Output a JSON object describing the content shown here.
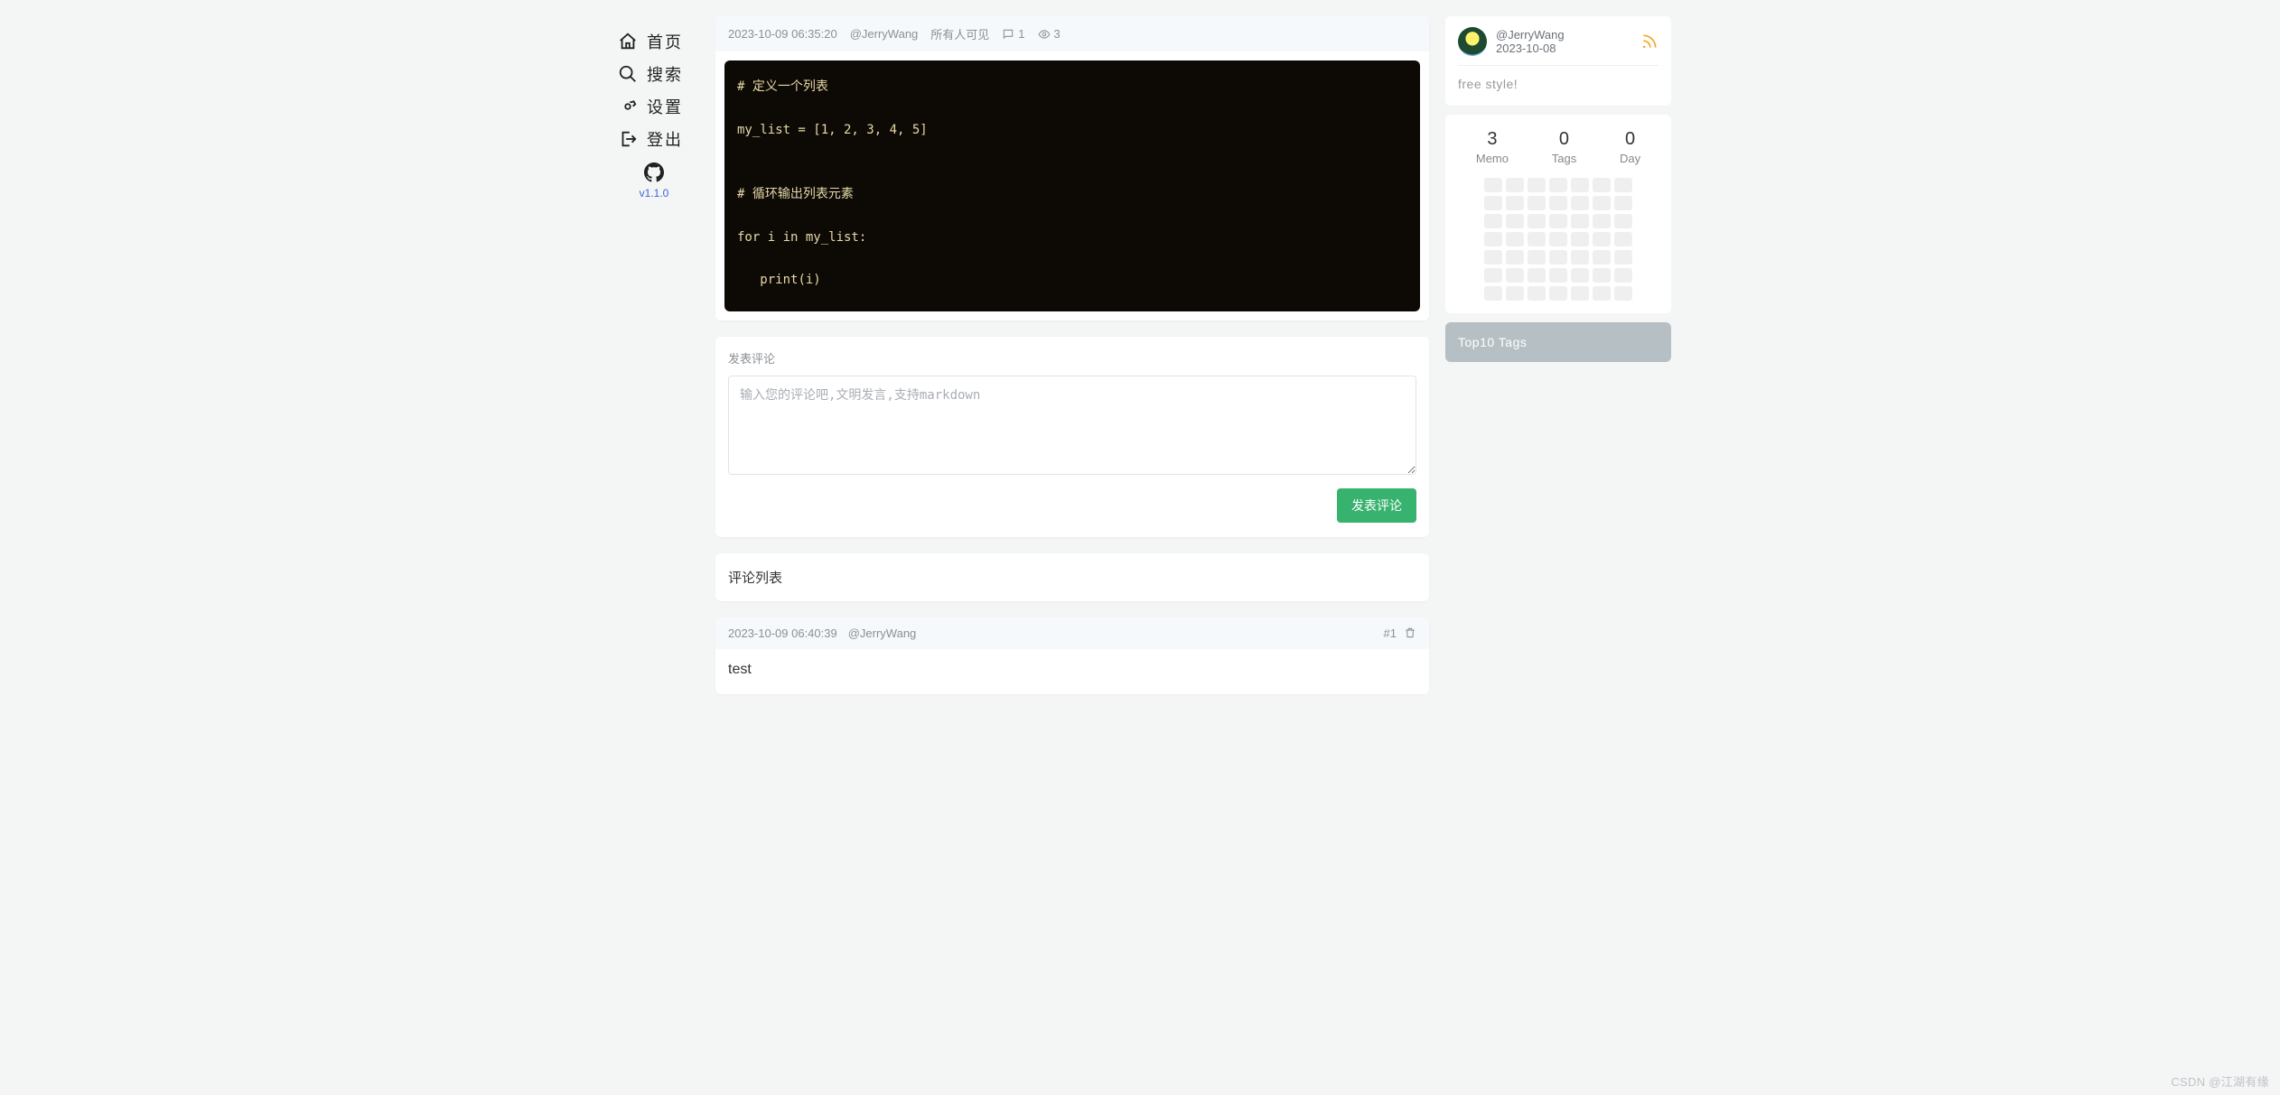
{
  "nav": {
    "items": [
      {
        "label": "首页"
      },
      {
        "label": "搜索"
      },
      {
        "label": "设置"
      },
      {
        "label": "登出"
      }
    ],
    "version": "v1.1.0"
  },
  "memo": {
    "timestamp": "2023-10-09 06:35:20",
    "author": "@JerryWang",
    "visibility": "所有人可见",
    "comment_count": "1",
    "view_count": "3",
    "code": "# 定义一个列表\n\nmy_list = [1, 2, 3, 4, 5]\n\n\n# 循环输出列表元素\n\nfor i in my_list:\n\n   print(i)"
  },
  "comment_box": {
    "section_label": "发表评论",
    "placeholder": "输入您的评论吧,文明发言,支持markdown",
    "submit_label": "发表评论"
  },
  "comment_list": {
    "header": "评论列表",
    "items": [
      {
        "timestamp": "2023-10-09 06:40:39",
        "author": "@JerryWang",
        "index": "#1",
        "body": "test"
      }
    ]
  },
  "profile": {
    "user": "@JerryWang",
    "date": "2023-10-08",
    "slogan": "free style!"
  },
  "stats": {
    "memo": {
      "num": "3",
      "lbl": "Memo"
    },
    "tags": {
      "num": "0",
      "lbl": "Tags"
    },
    "day": {
      "num": "0",
      "lbl": "Day"
    }
  },
  "tags_card": {
    "title": "Top10 Tags"
  },
  "watermark": "CSDN @江湖有缘"
}
